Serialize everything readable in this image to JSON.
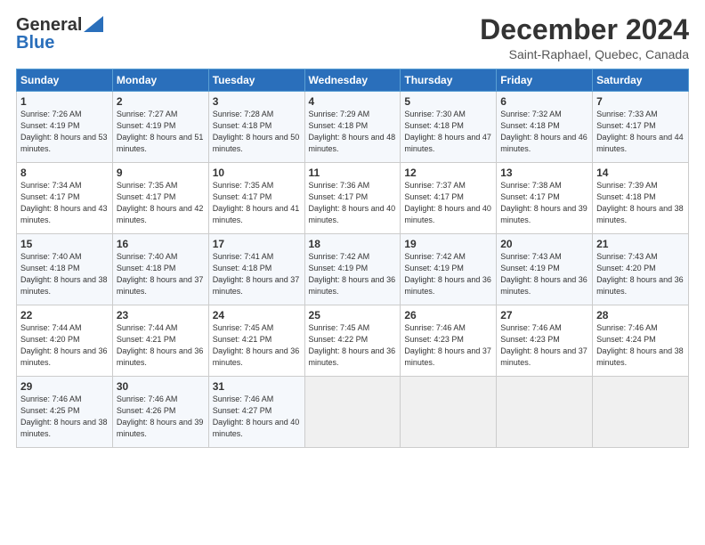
{
  "logo": {
    "line1": "General",
    "line2": "Blue"
  },
  "title": "December 2024",
  "location": "Saint-Raphael, Quebec, Canada",
  "days_of_week": [
    "Sunday",
    "Monday",
    "Tuesday",
    "Wednesday",
    "Thursday",
    "Friday",
    "Saturday"
  ],
  "weeks": [
    [
      {
        "day": "1",
        "sunrise": "Sunrise: 7:26 AM",
        "sunset": "Sunset: 4:19 PM",
        "daylight": "Daylight: 8 hours and 53 minutes."
      },
      {
        "day": "2",
        "sunrise": "Sunrise: 7:27 AM",
        "sunset": "Sunset: 4:19 PM",
        "daylight": "Daylight: 8 hours and 51 minutes."
      },
      {
        "day": "3",
        "sunrise": "Sunrise: 7:28 AM",
        "sunset": "Sunset: 4:18 PM",
        "daylight": "Daylight: 8 hours and 50 minutes."
      },
      {
        "day": "4",
        "sunrise": "Sunrise: 7:29 AM",
        "sunset": "Sunset: 4:18 PM",
        "daylight": "Daylight: 8 hours and 48 minutes."
      },
      {
        "day": "5",
        "sunrise": "Sunrise: 7:30 AM",
        "sunset": "Sunset: 4:18 PM",
        "daylight": "Daylight: 8 hours and 47 minutes."
      },
      {
        "day": "6",
        "sunrise": "Sunrise: 7:32 AM",
        "sunset": "Sunset: 4:18 PM",
        "daylight": "Daylight: 8 hours and 46 minutes."
      },
      {
        "day": "7",
        "sunrise": "Sunrise: 7:33 AM",
        "sunset": "Sunset: 4:17 PM",
        "daylight": "Daylight: 8 hours and 44 minutes."
      }
    ],
    [
      {
        "day": "8",
        "sunrise": "Sunrise: 7:34 AM",
        "sunset": "Sunset: 4:17 PM",
        "daylight": "Daylight: 8 hours and 43 minutes."
      },
      {
        "day": "9",
        "sunrise": "Sunrise: 7:35 AM",
        "sunset": "Sunset: 4:17 PM",
        "daylight": "Daylight: 8 hours and 42 minutes."
      },
      {
        "day": "10",
        "sunrise": "Sunrise: 7:35 AM",
        "sunset": "Sunset: 4:17 PM",
        "daylight": "Daylight: 8 hours and 41 minutes."
      },
      {
        "day": "11",
        "sunrise": "Sunrise: 7:36 AM",
        "sunset": "Sunset: 4:17 PM",
        "daylight": "Daylight: 8 hours and 40 minutes."
      },
      {
        "day": "12",
        "sunrise": "Sunrise: 7:37 AM",
        "sunset": "Sunset: 4:17 PM",
        "daylight": "Daylight: 8 hours and 40 minutes."
      },
      {
        "day": "13",
        "sunrise": "Sunrise: 7:38 AM",
        "sunset": "Sunset: 4:17 PM",
        "daylight": "Daylight: 8 hours and 39 minutes."
      },
      {
        "day": "14",
        "sunrise": "Sunrise: 7:39 AM",
        "sunset": "Sunset: 4:18 PM",
        "daylight": "Daylight: 8 hours and 38 minutes."
      }
    ],
    [
      {
        "day": "15",
        "sunrise": "Sunrise: 7:40 AM",
        "sunset": "Sunset: 4:18 PM",
        "daylight": "Daylight: 8 hours and 38 minutes."
      },
      {
        "day": "16",
        "sunrise": "Sunrise: 7:40 AM",
        "sunset": "Sunset: 4:18 PM",
        "daylight": "Daylight: 8 hours and 37 minutes."
      },
      {
        "day": "17",
        "sunrise": "Sunrise: 7:41 AM",
        "sunset": "Sunset: 4:18 PM",
        "daylight": "Daylight: 8 hours and 37 minutes."
      },
      {
        "day": "18",
        "sunrise": "Sunrise: 7:42 AM",
        "sunset": "Sunset: 4:19 PM",
        "daylight": "Daylight: 8 hours and 36 minutes."
      },
      {
        "day": "19",
        "sunrise": "Sunrise: 7:42 AM",
        "sunset": "Sunset: 4:19 PM",
        "daylight": "Daylight: 8 hours and 36 minutes."
      },
      {
        "day": "20",
        "sunrise": "Sunrise: 7:43 AM",
        "sunset": "Sunset: 4:19 PM",
        "daylight": "Daylight: 8 hours and 36 minutes."
      },
      {
        "day": "21",
        "sunrise": "Sunrise: 7:43 AM",
        "sunset": "Sunset: 4:20 PM",
        "daylight": "Daylight: 8 hours and 36 minutes."
      }
    ],
    [
      {
        "day": "22",
        "sunrise": "Sunrise: 7:44 AM",
        "sunset": "Sunset: 4:20 PM",
        "daylight": "Daylight: 8 hours and 36 minutes."
      },
      {
        "day": "23",
        "sunrise": "Sunrise: 7:44 AM",
        "sunset": "Sunset: 4:21 PM",
        "daylight": "Daylight: 8 hours and 36 minutes."
      },
      {
        "day": "24",
        "sunrise": "Sunrise: 7:45 AM",
        "sunset": "Sunset: 4:21 PM",
        "daylight": "Daylight: 8 hours and 36 minutes."
      },
      {
        "day": "25",
        "sunrise": "Sunrise: 7:45 AM",
        "sunset": "Sunset: 4:22 PM",
        "daylight": "Daylight: 8 hours and 36 minutes."
      },
      {
        "day": "26",
        "sunrise": "Sunrise: 7:46 AM",
        "sunset": "Sunset: 4:23 PM",
        "daylight": "Daylight: 8 hours and 37 minutes."
      },
      {
        "day": "27",
        "sunrise": "Sunrise: 7:46 AM",
        "sunset": "Sunset: 4:23 PM",
        "daylight": "Daylight: 8 hours and 37 minutes."
      },
      {
        "day": "28",
        "sunrise": "Sunrise: 7:46 AM",
        "sunset": "Sunset: 4:24 PM",
        "daylight": "Daylight: 8 hours and 38 minutes."
      }
    ],
    [
      {
        "day": "29",
        "sunrise": "Sunrise: 7:46 AM",
        "sunset": "Sunset: 4:25 PM",
        "daylight": "Daylight: 8 hours and 38 minutes."
      },
      {
        "day": "30",
        "sunrise": "Sunrise: 7:46 AM",
        "sunset": "Sunset: 4:26 PM",
        "daylight": "Daylight: 8 hours and 39 minutes."
      },
      {
        "day": "31",
        "sunrise": "Sunrise: 7:46 AM",
        "sunset": "Sunset: 4:27 PM",
        "daylight": "Daylight: 8 hours and 40 minutes."
      },
      null,
      null,
      null,
      null
    ]
  ]
}
